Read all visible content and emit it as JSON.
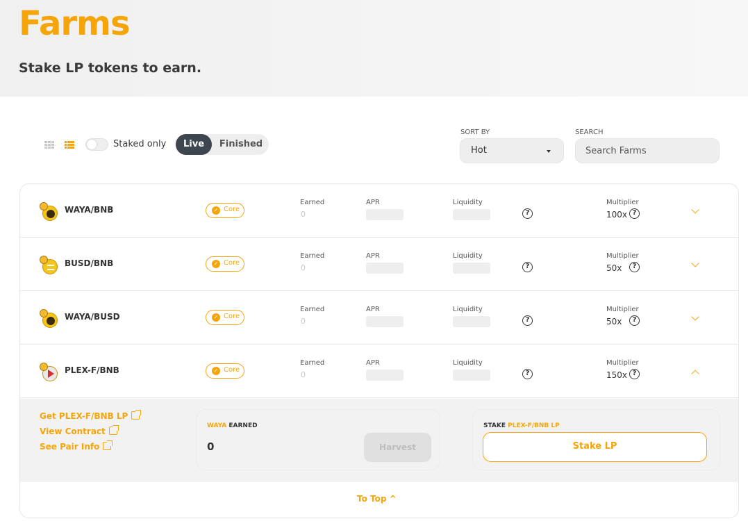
{
  "header": {
    "title": "Farms",
    "subtitle": "Stake LP tokens to earn."
  },
  "controls": {
    "staked_only_label": "Staked only",
    "tabs": [
      {
        "label": "Live"
      },
      {
        "label": "Finished"
      }
    ],
    "sort_by_label": "SORT BY",
    "sort_value": "Hot",
    "search_label": "SEARCH",
    "search_placeholder": "Search Farms"
  },
  "labels": {
    "core": "Core",
    "earned": "Earned",
    "apr": "APR",
    "liquidity": "Liquidity",
    "multiplier": "Multiplier"
  },
  "farms": [
    {
      "pair": "WAYA/BNB",
      "earned": "0",
      "multiplier": "100x"
    },
    {
      "pair": "BUSD/BNB",
      "earned": "0",
      "multiplier": "50x"
    },
    {
      "pair": "WAYA/BUSD",
      "earned": "0",
      "multiplier": "50x"
    },
    {
      "pair": "PLEX-F/BNB",
      "earned": "0",
      "multiplier": "150x"
    }
  ],
  "details": {
    "links": [
      "Get PLEX-F/BNB LP",
      "View Contract",
      "See Pair Info"
    ],
    "earned_token": "WAYA",
    "earned_word": "EARNED",
    "earned_value": "0",
    "harvest_label": "Harvest",
    "stake_prefix": "STAKE",
    "stake_token": "PLEX-F/BNB LP",
    "stake_button": "Stake LP",
    "to_top": "To Top ^"
  },
  "colors": {
    "accent": "#f5a50a",
    "dark": "#3e4650"
  }
}
